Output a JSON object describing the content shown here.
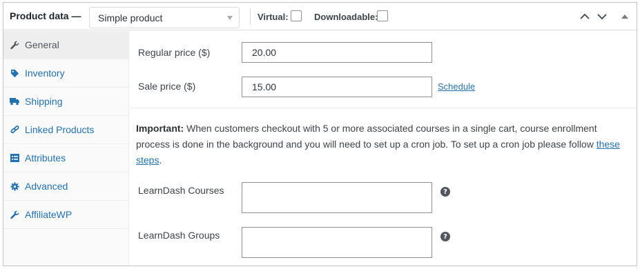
{
  "header": {
    "title": "Product data —",
    "product_type": "Simple product",
    "virtual_label": "Virtual:",
    "downloadable_label": "Downloadable:"
  },
  "sidebar": {
    "items": [
      {
        "label": "General",
        "icon": "wrench-icon",
        "active": true
      },
      {
        "label": "Inventory",
        "icon": "tag-icon",
        "active": false
      },
      {
        "label": "Shipping",
        "icon": "truck-icon",
        "active": false
      },
      {
        "label": "Linked Products",
        "icon": "link-icon",
        "active": false
      },
      {
        "label": "Attributes",
        "icon": "list-icon",
        "active": false
      },
      {
        "label": "Advanced",
        "icon": "gear-icon",
        "active": false
      },
      {
        "label": "AffiliateWP",
        "icon": "wrench-icon",
        "active": false
      }
    ]
  },
  "general": {
    "regular_price_label": "Regular price ($)",
    "regular_price_value": "20.00",
    "sale_price_label": "Sale price ($)",
    "sale_price_value": "15.00",
    "schedule_link": "Schedule",
    "notice_strong": "Important:",
    "notice_text": " When customers checkout with 5 or more associated courses in a single cart, course enrollment process is done in the background and you will need to set up a cron job. To set up a cron job please follow ",
    "notice_link": "these steps",
    "notice_end": ".",
    "courses_label": "LearnDash Courses",
    "groups_label": "LearnDash Groups",
    "help_glyph": "?"
  },
  "colors": {
    "link": "#2271b1",
    "text": "#3c434a",
    "border": "#c3c4c7"
  }
}
